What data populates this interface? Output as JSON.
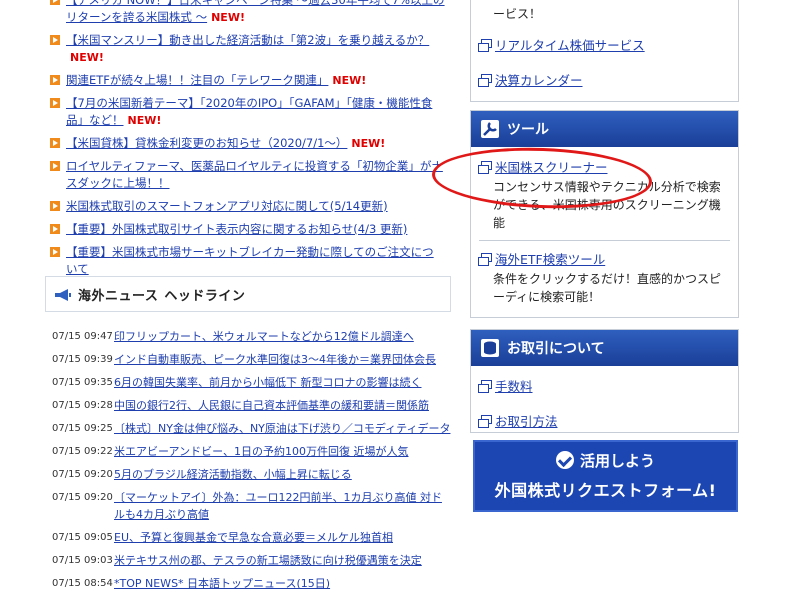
{
  "announcements": [
    {
      "text": "【アメリカ NOW！】日米キャンペーン特集 ～過去30年平均で7%以上のリターンを誇る米国株式 ～",
      "new": true
    },
    {
      "text": "【米国マンスリー】動き出した経済活動は「第2波」を乗り越えるか？",
      "new": true
    },
    {
      "text": "関連ETFが続々上場！！注目の「テレワーク関連」",
      "new": true
    },
    {
      "text": "【7月の米国新着テーマ】「2020年のIPO」「GAFAM」「健康・機能性食品」など！",
      "new": true
    },
    {
      "text": "【米国貸株】貸株金利変更のお知らせ（2020/7/1～）",
      "new": true
    },
    {
      "text": "ロイヤルティファーマ、医薬品ロイヤルティに投資する「初物企業」がナスダックに上場！！",
      "new": false
    },
    {
      "text": "米国株式取引のスマートフォンアプリ対応に関して(5/14更新)",
      "new": false
    },
    {
      "text": "【重要】外国株式取引サイト表示内容に関するお知らせ(4/3 更新)",
      "new": false
    },
    {
      "text": "【重要】米国株式市場サーキットブレイカー発動に際してのご注文について",
      "new": false
    }
  ],
  "new_label": "NEW!",
  "overseas_news": {
    "title": "海外ニュース",
    "subtitle": "ヘッドライン",
    "items": [
      {
        "time": "07/15 09:47",
        "headline": "印フリップカート、米ウォルマートなどから12億ドル調達へ"
      },
      {
        "time": "07/15 09:39",
        "headline": "インド自動車販売、ピーク水準回復は3～4年後か＝業界団体会長"
      },
      {
        "time": "07/15 09:35",
        "headline": "6月の韓国失業率、前月から小幅低下 新型コロナの影響は続く"
      },
      {
        "time": "07/15 09:28",
        "headline": "中国の銀行2行、人民銀に自己資本評価基準の緩和要請＝関係筋"
      },
      {
        "time": "07/15 09:25",
        "headline": "〔株式〕NY金は伸び悩み、NY原油は下げ渋り／コモディティデータ"
      },
      {
        "time": "07/15 09:22",
        "headline": "米エアビーアンドビー、1日の予約100万件回復 近場が人気"
      },
      {
        "time": "07/15 09:20",
        "headline": "5月のブラジル経済活動指数、小幅上昇に転じる"
      },
      {
        "time": "07/15 09:20",
        "headline": "〔マーケットアイ〕外為：ユーロ122円前半、1カ月ぶり高値 対ドルも4カ月ぶり高値"
      },
      {
        "time": "07/15 09:05",
        "headline": "EU、予算と復興基金で早急な合意必要＝メルケル独首相"
      },
      {
        "time": "07/15 09:03",
        "headline": "米テキサス州の郡、テスラの新工場誘致に向け税優遇策を決定"
      },
      {
        "time": "07/15 08:54",
        "headline": "*TOP NEWS* 日本語トップニュース(15日)"
      }
    ]
  },
  "right": {
    "top_fragment": "ービス！",
    "links_top": [
      "リアルタイム株価サービス",
      "決算カレンダー"
    ],
    "tools": {
      "title": "ツール",
      "screener": {
        "label": "米国株スクリーナー",
        "desc": "コンセンサス情報やテクニカル分析で検索ができる、米国株専用のスクリーニング機能"
      },
      "etf": {
        "label": "海外ETF検索ツール",
        "desc": "条件をクリックするだけ！直感的かつスピーディに検索可能！"
      }
    },
    "trading": {
      "title": "お取引について",
      "links": [
        "手数料",
        "お取引方法"
      ]
    },
    "cta": {
      "line1": "活用しよう",
      "line2": "外国株式リクエストフォーム!"
    }
  },
  "colors": {
    "bullet": "#f08a1a",
    "link": "#1f3fae",
    "new": "#e00000",
    "blue_header": "#1a3f98",
    "annotation": "#e01818"
  }
}
